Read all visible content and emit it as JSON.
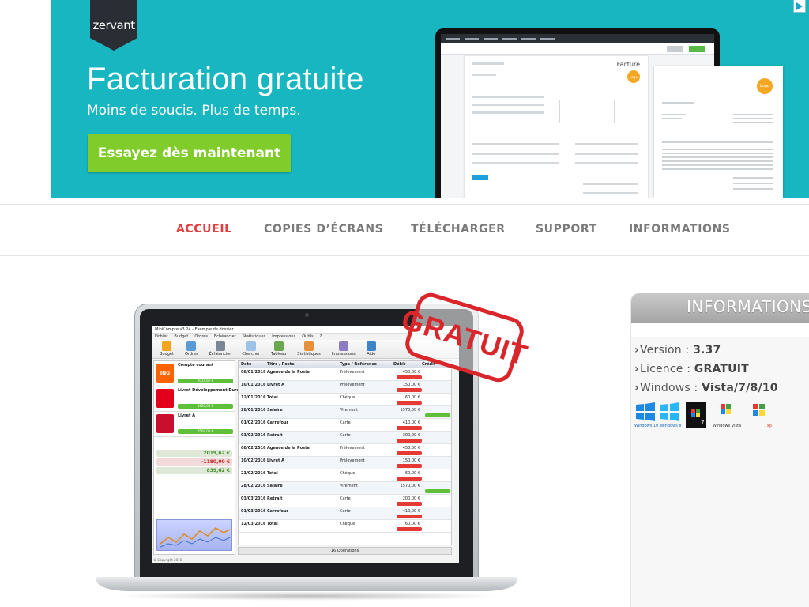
{
  "ad": {
    "brand": "zervant",
    "title": "Facturation gratuite",
    "subtitle": "Moins de soucis. Plus de temps.",
    "cta": "Essayez dès maintenant",
    "mock_doc_title": "Facture",
    "mock_logo": "Logo",
    "colors": {
      "background": "#17b6c0",
      "cta": "#7fcc2a"
    }
  },
  "nav": {
    "items": [
      {
        "label": "ACCUEIL",
        "active": true
      },
      {
        "label": "COPIES D’ÉCRANS",
        "active": false
      },
      {
        "label": "TÉLÉCHARGER",
        "active": false
      },
      {
        "label": "SUPPORT",
        "active": false
      },
      {
        "label": "INFORMATIONS",
        "active": false
      }
    ],
    "active_color": "#e0403f"
  },
  "screenshot": {
    "window_title": "MiniCompte v3.24 - Exemple de dossier",
    "menu": [
      "Fichier",
      "Budget",
      "Ordres",
      "Échéancier",
      "Statistiques",
      "Impressions",
      "Outils",
      "?"
    ],
    "ribbon": [
      "Budget",
      "Ordres",
      "Échéancier",
      "Chercher",
      "Tableau",
      "Statistiques",
      "Impressions",
      "Aide"
    ],
    "accounts": [
      {
        "bank": "ING",
        "name": "Compte courant",
        "balance": "2019,62 €"
      },
      {
        "bank": "",
        "name": "Livret Développement Durable",
        "balance": "1900,00 €"
      },
      {
        "bank": "",
        "name": "Livret A",
        "balance": "4500,00 €"
      }
    ],
    "summary": [
      "2019,62 €",
      "-1180,00 €",
      "839,62 €"
    ],
    "columns": [
      "Date",
      "Titre / Poste",
      "Type / Référence",
      "Débit",
      "Crédit"
    ],
    "rows": [
      {
        "date": "08/01/2016",
        "title": "Agence de la Poste",
        "type": "Prélèvement",
        "amount": "450,00 €"
      },
      {
        "date": "10/01/2016",
        "title": "Livret A",
        "type": "Prélèvement",
        "amount": "150,00 €"
      },
      {
        "date": "12/01/2016",
        "title": "Total",
        "type": "Chèque",
        "amount": "60,00 €"
      },
      {
        "date": "28/01/2016",
        "title": "Salaire",
        "type": "Virement",
        "amount": "1570,00 €"
      },
      {
        "date": "01/02/2016",
        "title": "Carrefour",
        "type": "Carte",
        "amount": "410,00 €"
      },
      {
        "date": "03/02/2016",
        "title": "Retrait",
        "type": "Carte",
        "amount": "300,00 €"
      },
      {
        "date": "08/02/2016",
        "title": "Agence de la Poste",
        "type": "Prélèvement",
        "amount": "450,00 €"
      },
      {
        "date": "10/02/2016",
        "title": "Livret A",
        "type": "Prélèvement",
        "amount": "150,00 €"
      },
      {
        "date": "23/02/2016",
        "title": "Total",
        "type": "Chèque",
        "amount": "60,00 €"
      },
      {
        "date": "28/02/2016",
        "title": "Salaire",
        "type": "Virement",
        "amount": "1570,00 €"
      },
      {
        "date": "03/03/2016",
        "title": "Retrait",
        "type": "Carte",
        "amount": "200,00 €"
      },
      {
        "date": "01/03/2016",
        "title": "Carrefour",
        "type": "Carte",
        "amount": "410,00 €"
      },
      {
        "date": "12/03/2016",
        "title": "Total",
        "type": "Chèque",
        "amount": "60,00 €"
      }
    ],
    "status": "16 Opérations",
    "copyright": "© Copyright 2016",
    "stamp": "GRATUIT"
  },
  "info": {
    "header": "INFORMATIONS",
    "version_label": "Version :",
    "version": "3.37",
    "licence_label": "Licence :",
    "licence": "GRATUIT",
    "windows_label": "Windows :",
    "windows": "Vista/7/8/10",
    "os_logos": [
      {
        "icon": "windows-10-icon",
        "caption": "Windows 10"
      },
      {
        "icon": "windows-8-icon",
        "caption": "Windows 8"
      },
      {
        "icon": "windows-7-icon",
        "caption": "Windows 7"
      },
      {
        "icon": "windows-vista-icon",
        "caption": "Windows Vista"
      },
      {
        "icon": "windows-xp-icon",
        "caption": "xp"
      }
    ]
  }
}
